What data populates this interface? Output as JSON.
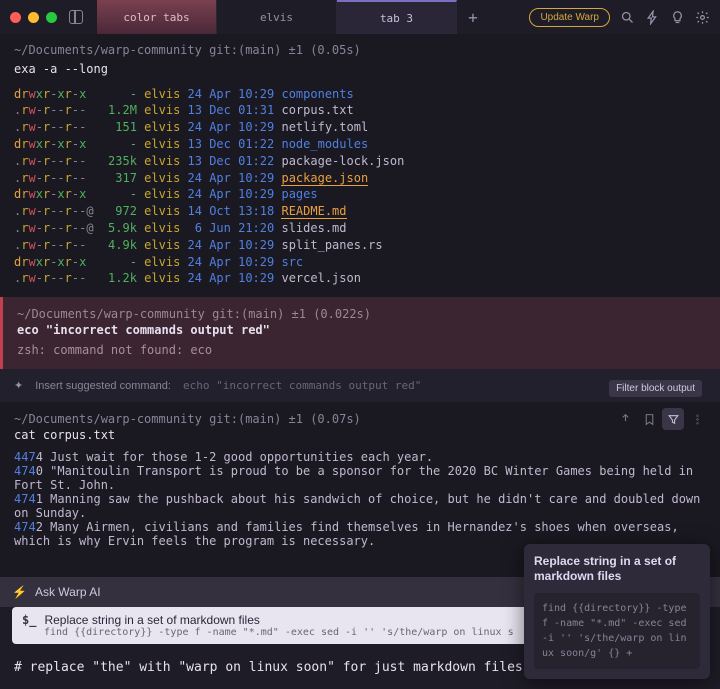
{
  "tabs": [
    "color tabs",
    "elvis",
    "tab 3"
  ],
  "update_btn": "Update Warp",
  "block1": {
    "prompt": "~/Documents/warp-community git:(main) ±1 (0.05s)",
    "cmd": "exa -a --long",
    "rows": [
      {
        "perm": "drwxr-xr-x",
        "size": "-",
        "user": "elvis",
        "date": "24 Apr 10:29",
        "name": "components",
        "dir": true
      },
      {
        "perm": ".rw-r--r--",
        "size": "1.2M",
        "user": "elvis",
        "date": "13 Dec 01:31",
        "name": "corpus.txt"
      },
      {
        "perm": ".rw-r--r--",
        "size": "151",
        "user": "elvis",
        "date": "24 Apr 10:29",
        "name": "netlify.toml"
      },
      {
        "perm": "drwxr-xr-x",
        "size": "-",
        "user": "elvis",
        "date": "13 Dec 01:22",
        "name": "node_modules",
        "dir": true
      },
      {
        "perm": ".rw-r--r--",
        "size": "235k",
        "user": "elvis",
        "date": "13 Dec 01:22",
        "name": "package-lock.json"
      },
      {
        "perm": ".rw-r--r--",
        "size": "317",
        "user": "elvis",
        "date": "24 Apr 10:29",
        "name": "package.json",
        "hl": true
      },
      {
        "perm": "drwxr-xr-x",
        "size": "-",
        "user": "elvis",
        "date": "24 Apr 10:29",
        "name": "pages",
        "dir": true
      },
      {
        "perm": ".rw-r--r--@",
        "size": "972",
        "user": "elvis",
        "date": "14 Oct 13:18",
        "name": "README.md",
        "hl": true
      },
      {
        "perm": ".rw-r--r--@",
        "size": "5.9k",
        "user": "elvis",
        "date": " 6 Jun 21:20",
        "name": "slides.md"
      },
      {
        "perm": ".rw-r--r--",
        "size": "4.9k",
        "user": "elvis",
        "date": "24 Apr 10:29",
        "name": "split_panes.rs"
      },
      {
        "perm": "drwxr-xr-x",
        "size": "-",
        "user": "elvis",
        "date": "24 Apr 10:29",
        "name": "src",
        "dir": true
      },
      {
        "perm": ".rw-r--r--",
        "size": "1.2k",
        "user": "elvis",
        "date": "24 Apr 10:29",
        "name": "vercel.json"
      }
    ]
  },
  "block2": {
    "prompt": "~/Documents/warp-community git:(main) ±1 (0.022s)",
    "cmd": "eco \"incorrect commands output red\"",
    "out": "zsh: command not found: eco"
  },
  "suggest": {
    "label": "Insert suggested command:",
    "cmd": "echo \"incorrect commands output red\""
  },
  "tooltip": "Filter block output",
  "block3": {
    "prompt": "~/Documents/warp-community git:(main) ±1 (0.07s)",
    "cmd": "cat corpus.txt",
    "lines": [
      {
        "n": "4474",
        "txt": "   Just wait for those 1-2 good opportunities each year."
      },
      {
        "n": "4740",
        "txt": "   \"Manitoulin Transport is proud to be a sponsor for the 2020 BC Winter Games being held in Fort St. John."
      },
      {
        "n": "4741",
        "txt": "   Manning saw the pushback about his sandwich of choice, but he didn't care and doubled down on Sunday."
      },
      {
        "n": "4742",
        "txt": "   Many Airmen, civilians and families find themselves in Hernandez's shoes when overseas, which is why Ervin feels the program is necessary."
      }
    ]
  },
  "ai_bar": "Ask Warp AI",
  "suggestion": {
    "title": "Replace string in a set of markdown files",
    "cmd": "find {{directory}} -type f -name \"*.md\" -exec sed -i '' 's/the/warp on linux s"
  },
  "input": "# replace \"the\" with \"warp on linux soon\" for just markdown files",
  "preview": {
    "title": "Replace string in a set of markdown files",
    "code": "find {{directory}} -type f -name \"*.md\" -exec sed -i '' 's/the/warp on linux soon/g' {} +"
  }
}
